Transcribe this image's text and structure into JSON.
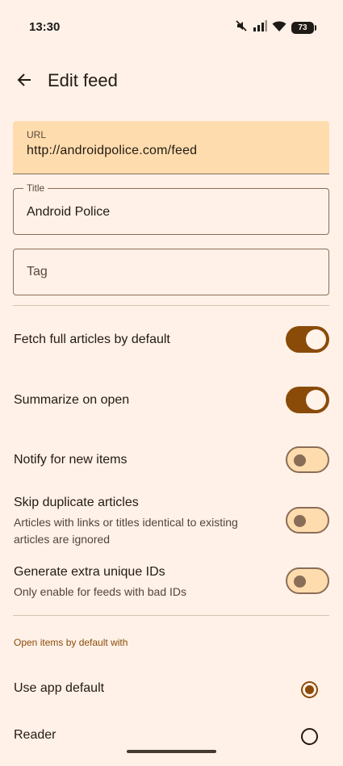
{
  "status_bar": {
    "time": "13:30",
    "battery": "73",
    "icons": [
      "mute-icon",
      "signal-icon",
      "wifi-icon",
      "battery-icon"
    ]
  },
  "app_bar": {
    "title": "Edit feed",
    "back_icon": "arrow-back-icon"
  },
  "form": {
    "url": {
      "label": "URL",
      "value": "http://androidpolice.com/feed"
    },
    "title": {
      "label": "Title",
      "value": "Android Police"
    },
    "tag": {
      "placeholder": "Tag"
    }
  },
  "settings": [
    {
      "title": "Fetch full articles by default",
      "subtitle": "",
      "on": true
    },
    {
      "title": "Summarize on open",
      "subtitle": "",
      "on": true
    },
    {
      "title": "Notify for new items",
      "subtitle": "",
      "on": false
    },
    {
      "title": "Skip duplicate articles",
      "subtitle": "Articles with links or titles identical to existing articles are ignored",
      "on": false
    },
    {
      "title": "Generate extra unique IDs",
      "subtitle": "Only enable for feeds with bad IDs",
      "on": false
    }
  ],
  "open_with": {
    "section_label": "Open items by default with",
    "options": [
      {
        "label": "Use app default",
        "selected": true
      },
      {
        "label": "Reader",
        "selected": false
      }
    ]
  },
  "colors": {
    "background": "#fff1e8",
    "accent": "#8a4b08",
    "field_fill": "#ffdcae",
    "outline": "#8a6d56"
  }
}
